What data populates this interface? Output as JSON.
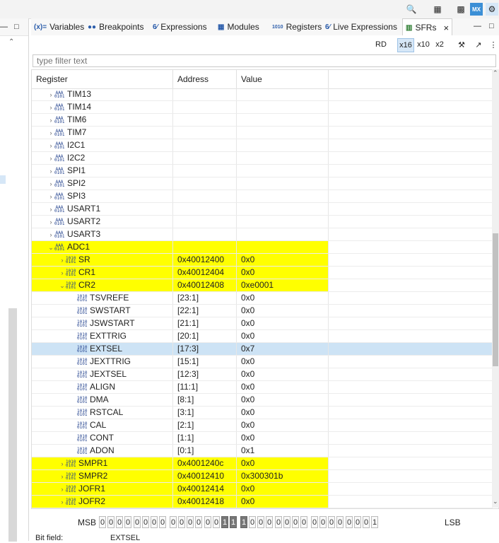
{
  "tabs": [
    {
      "icon": "(x)=",
      "label": "Variables"
    },
    {
      "icon": "●●",
      "label": "Breakpoints"
    },
    {
      "icon": "6⁄",
      "label": "Expressions"
    },
    {
      "icon": "▦",
      "label": "Modules"
    },
    {
      "icon": "1010",
      "label": "Registers"
    },
    {
      "icon": "6⁄",
      "label": "Live Expressions"
    },
    {
      "icon": "▥",
      "label": "SFRs",
      "active": true
    }
  ],
  "toolbar": {
    "rd": "RD",
    "x16": "x16",
    "x10": "x10",
    "x2": "x2"
  },
  "filter": {
    "placeholder": "type filter text"
  },
  "columns": {
    "register": "Register",
    "address": "Address",
    "value": "Value"
  },
  "rows": [
    {
      "name": "TIM13",
      "level": 0,
      "state": "collapsed",
      "address": "",
      "value": "",
      "style": ""
    },
    {
      "name": "TIM14",
      "level": 0,
      "state": "collapsed",
      "address": "",
      "value": "",
      "style": ""
    },
    {
      "name": "TIM6",
      "level": 0,
      "state": "collapsed",
      "address": "",
      "value": "",
      "style": ""
    },
    {
      "name": "TIM7",
      "level": 0,
      "state": "collapsed",
      "address": "",
      "value": "",
      "style": ""
    },
    {
      "name": "I2C1",
      "level": 0,
      "state": "collapsed",
      "address": "",
      "value": "",
      "style": ""
    },
    {
      "name": "I2C2",
      "level": 0,
      "state": "collapsed",
      "address": "",
      "value": "",
      "style": ""
    },
    {
      "name": "SPI1",
      "level": 0,
      "state": "collapsed",
      "address": "",
      "value": "",
      "style": ""
    },
    {
      "name": "SPI2",
      "level": 0,
      "state": "collapsed",
      "address": "",
      "value": "",
      "style": ""
    },
    {
      "name": "SPI3",
      "level": 0,
      "state": "collapsed",
      "address": "",
      "value": "",
      "style": ""
    },
    {
      "name": "USART1",
      "level": 0,
      "state": "collapsed",
      "address": "",
      "value": "",
      "style": ""
    },
    {
      "name": "USART2",
      "level": 0,
      "state": "collapsed",
      "address": "",
      "value": "",
      "style": ""
    },
    {
      "name": "USART3",
      "level": 0,
      "state": "collapsed",
      "address": "",
      "value": "",
      "style": ""
    },
    {
      "name": "ADC1",
      "level": 0,
      "state": "expanded",
      "address": "",
      "value": "",
      "style": "hl"
    },
    {
      "name": "SR",
      "level": 1,
      "state": "collapsed",
      "address": "0x40012400",
      "value": "0x0",
      "style": "hl"
    },
    {
      "name": "CR1",
      "level": 1,
      "state": "collapsed",
      "address": "0x40012404",
      "value": "0x0",
      "style": "hl"
    },
    {
      "name": "CR2",
      "level": 1,
      "state": "expanded",
      "address": "0x40012408",
      "value": "0xe0001",
      "style": "hl"
    },
    {
      "name": "TSVREFE",
      "level": 2,
      "state": "leaf",
      "address": "[23:1]",
      "value": "0x0",
      "style": ""
    },
    {
      "name": "SWSTART",
      "level": 2,
      "state": "leaf",
      "address": "[22:1]",
      "value": "0x0",
      "style": ""
    },
    {
      "name": "JSWSTART",
      "level": 2,
      "state": "leaf",
      "address": "[21:1]",
      "value": "0x0",
      "style": ""
    },
    {
      "name": "EXTTRIG",
      "level": 2,
      "state": "leaf",
      "address": "[20:1]",
      "value": "0x0",
      "style": ""
    },
    {
      "name": "EXTSEL",
      "level": 2,
      "state": "leaf",
      "address": "[17:3]",
      "value": "0x7",
      "style": "sel"
    },
    {
      "name": "JEXTTRIG",
      "level": 2,
      "state": "leaf",
      "address": "[15:1]",
      "value": "0x0",
      "style": ""
    },
    {
      "name": "JEXTSEL",
      "level": 2,
      "state": "leaf",
      "address": "[12:3]",
      "value": "0x0",
      "style": ""
    },
    {
      "name": "ALIGN",
      "level": 2,
      "state": "leaf",
      "address": "[11:1]",
      "value": "0x0",
      "style": ""
    },
    {
      "name": "DMA",
      "level": 2,
      "state": "leaf",
      "address": "[8:1]",
      "value": "0x0",
      "style": ""
    },
    {
      "name": "RSTCAL",
      "level": 2,
      "state": "leaf",
      "address": "[3:1]",
      "value": "0x0",
      "style": ""
    },
    {
      "name": "CAL",
      "level": 2,
      "state": "leaf",
      "address": "[2:1]",
      "value": "0x0",
      "style": ""
    },
    {
      "name": "CONT",
      "level": 2,
      "state": "leaf",
      "address": "[1:1]",
      "value": "0x0",
      "style": ""
    },
    {
      "name": "ADON",
      "level": 2,
      "state": "leaf",
      "address": "[0:1]",
      "value": "0x1",
      "style": ""
    },
    {
      "name": "SMPR1",
      "level": 1,
      "state": "collapsed",
      "address": "0x4001240c",
      "value": "0x0",
      "style": "hl"
    },
    {
      "name": "SMPR2",
      "level": 1,
      "state": "collapsed",
      "address": "0x40012410",
      "value": "0x300301b",
      "style": "hl"
    },
    {
      "name": "JOFR1",
      "level": 1,
      "state": "collapsed",
      "address": "0x40012414",
      "value": "0x0",
      "style": "hl"
    },
    {
      "name": "JOFR2",
      "level": 1,
      "state": "collapsed",
      "address": "0x40012418",
      "value": "0x0",
      "style": "hl"
    }
  ],
  "bitfield": {
    "msb": "MSB",
    "lsb": "LSB",
    "bits": [
      "0",
      "0",
      "0",
      "0",
      "0",
      "0",
      "0",
      "0",
      "0",
      "0",
      "0",
      "0",
      "0",
      "0",
      "1",
      "1",
      "1",
      "0",
      "0",
      "0",
      "0",
      "0",
      "0",
      "0",
      "0",
      "0",
      "0",
      "0",
      "0",
      "0",
      "0",
      "1"
    ]
  },
  "footer": {
    "label": "Bit field:",
    "value": "EXTSEL"
  },
  "colors": {
    "highlight": "#ffff00",
    "selected": "#cde3f5"
  }
}
